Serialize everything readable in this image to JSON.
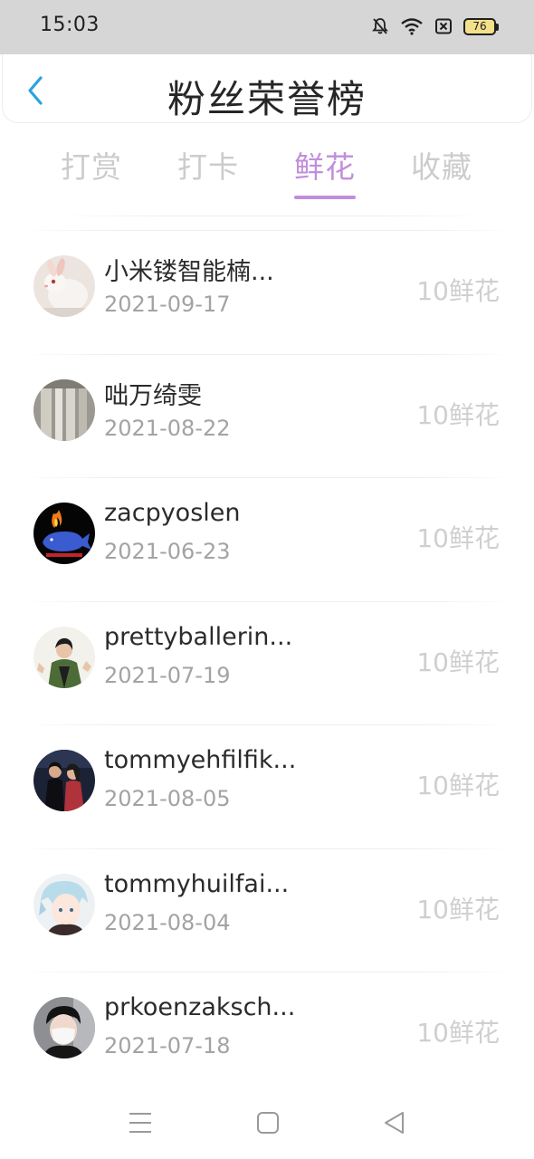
{
  "status_bar": {
    "time": "15:03",
    "battery": "76",
    "icons": [
      "bell-off-icon",
      "wifi-icon",
      "sim-off-icon",
      "battery-icon"
    ]
  },
  "header": {
    "title": "粉丝荣誉榜",
    "back_icon": "chevron-left-icon",
    "accent": "#2aa3e0"
  },
  "tabs": {
    "items": [
      {
        "label": "打赏"
      },
      {
        "label": "打卡"
      },
      {
        "label": "鲜花"
      },
      {
        "label": "收藏"
      }
    ],
    "active_index": 2,
    "active_color": "#c28edb",
    "inactive_color": "#cccccc"
  },
  "list": {
    "rows": [
      {
        "name": "小米镂智能楠...",
        "date": "2021-09-17",
        "amount": "10鲜花",
        "avatar": "rabbit-photo-avatar"
      },
      {
        "name": "咄万绮雯",
        "date": "2021-08-22",
        "amount": "10鲜花",
        "avatar": "curtain-photo-avatar"
      },
      {
        "name": "zacpyoslen",
        "date": "2021-06-23",
        "amount": "10鲜花",
        "avatar": "whale-fire-avatar"
      },
      {
        "name": "prettyballerin...",
        "date": "2021-07-19",
        "amount": "10鲜花",
        "avatar": "person-green-jacket-avatar"
      },
      {
        "name": "tommyehfilfik...",
        "date": "2021-08-05",
        "amount": "10鲜花",
        "avatar": "couple-photo-avatar"
      },
      {
        "name": "tommyhuilfai...",
        "date": "2021-08-04",
        "amount": "10鲜花",
        "avatar": "anime-character-avatar"
      },
      {
        "name": "prkoenzaksch...",
        "date": "2021-07-18",
        "amount": "10鲜花",
        "avatar": "masked-person-avatar"
      }
    ]
  },
  "nav_bar": {
    "icons": [
      "menu-icon",
      "home-square-icon",
      "back-triangle-icon"
    ]
  }
}
